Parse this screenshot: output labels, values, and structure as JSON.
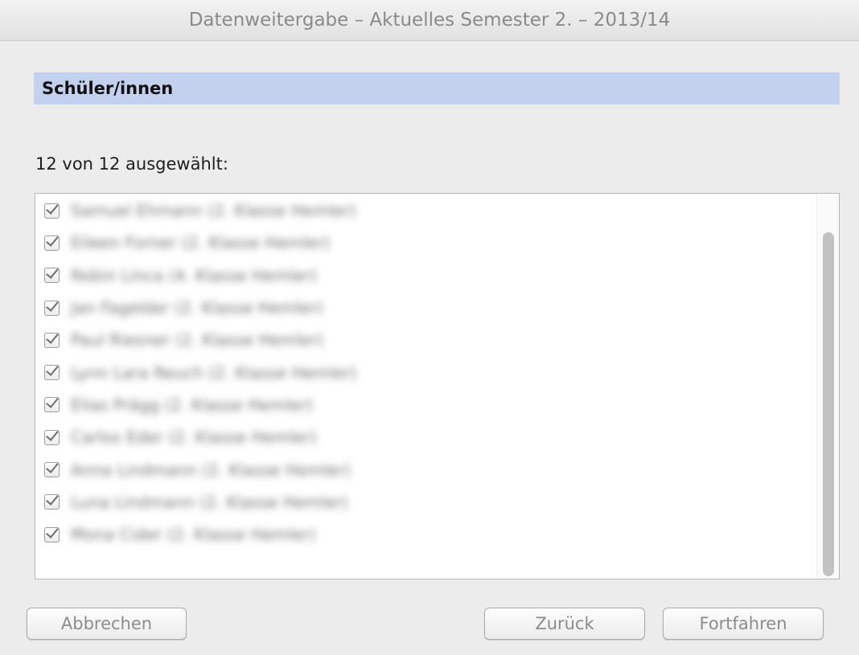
{
  "window": {
    "title": "Datenweitergabe – Aktuelles Semester 2. – 2013/14"
  },
  "section": {
    "header": "Schüler/innen"
  },
  "selection": {
    "label": "12 von 12 ausgewählt:"
  },
  "students": [
    {
      "name": "Samuel Ehmann (2. Klasse Hemler)",
      "checked": true
    },
    {
      "name": "Eileen Forner (2. Klasse Hemler)",
      "checked": true
    },
    {
      "name": "Robin Linca (4. Klasse Hemler)",
      "checked": true
    },
    {
      "name": "Jan Fagelder (2. Klasse Hemler)",
      "checked": true
    },
    {
      "name": "Paul Riesner (2. Klasse Hemler)",
      "checked": true
    },
    {
      "name": "Lynn Lara Reuch (2. Klasse Hemler)",
      "checked": true
    },
    {
      "name": "Elias Prägg (2. Klasse Hemler)",
      "checked": true
    },
    {
      "name": "Carlos Eder (2. Klasse Hemler)",
      "checked": true
    },
    {
      "name": "Anna Lindmann (2. Klasse Hemler)",
      "checked": true
    },
    {
      "name": "Luna Lindmann (2. Klasse Hemler)",
      "checked": true
    },
    {
      "name": "Mona Cider (2. Klasse Hemler)",
      "checked": true
    }
  ],
  "buttons": {
    "cancel": "Abbrechen",
    "back": "Zurück",
    "next": "Fortfahren"
  }
}
